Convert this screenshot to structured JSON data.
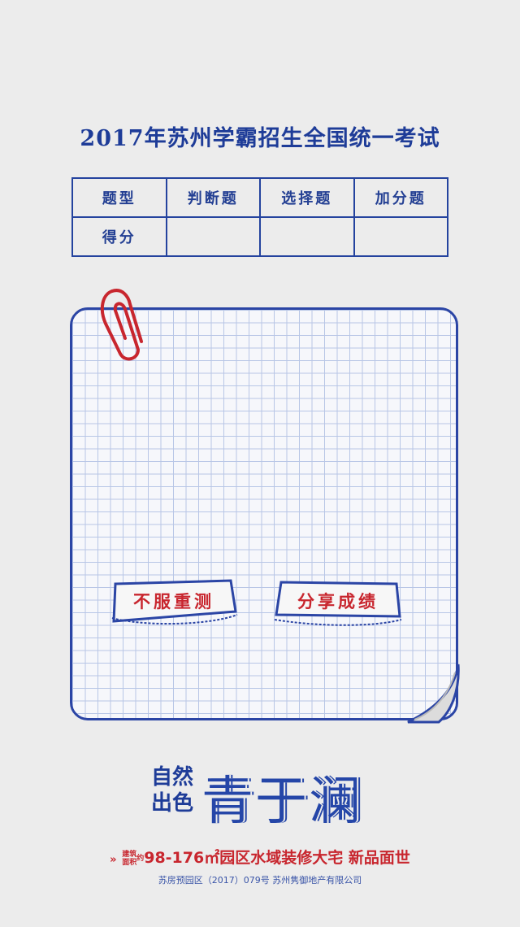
{
  "title": "2017年苏州学霸招生全国统一考试",
  "score_table": {
    "headers": [
      "题型",
      "判断题",
      "选择题",
      "加分题"
    ],
    "row_label": "得分",
    "row_values": [
      "",
      "",
      ""
    ]
  },
  "buttons": {
    "retry": "不服重测",
    "share": "分享成绩"
  },
  "logo": {
    "left_line1": "自然",
    "left_line2": "出色",
    "name": "青于澜"
  },
  "slogan": {
    "arrow": "»",
    "area_label_1": "建筑",
    "area_label_2": "面积",
    "area_suffix": "约",
    "text": "98-176㎡园区水域装修大宅  新品面世"
  },
  "license": "苏房预园区（2017）079号   苏州隽御地产有限公司",
  "colors": {
    "primary_blue": "#1e3c98",
    "accent_red": "#c8262e",
    "background": "#ececec"
  }
}
